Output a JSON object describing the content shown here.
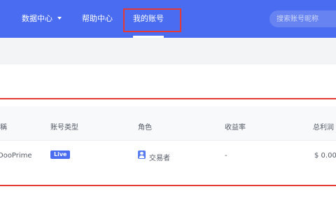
{
  "nav": {
    "items": [
      {
        "label": "数据中心"
      },
      {
        "label": "帮助中心"
      },
      {
        "label": "我的账号"
      }
    ]
  },
  "search": {
    "placeholder": "搜索账号昵称"
  },
  "table": {
    "headers": [
      "稱",
      "账号类型",
      "角色",
      "收益率",
      "总利润"
    ],
    "rows": [
      {
        "name": "DooPrime",
        "type_badge": "Live",
        "role": "交易者",
        "yield": "-",
        "profit": "$ 0.00"
      }
    ]
  },
  "colors": {
    "primary": "#4a6cf0",
    "highlight_red": "#e53935",
    "header_row_bg": "#f8f9fb",
    "toolbar_bg": "#f3f4f6"
  },
  "icons": [
    "caret-down-icon",
    "user-role-icon"
  ]
}
